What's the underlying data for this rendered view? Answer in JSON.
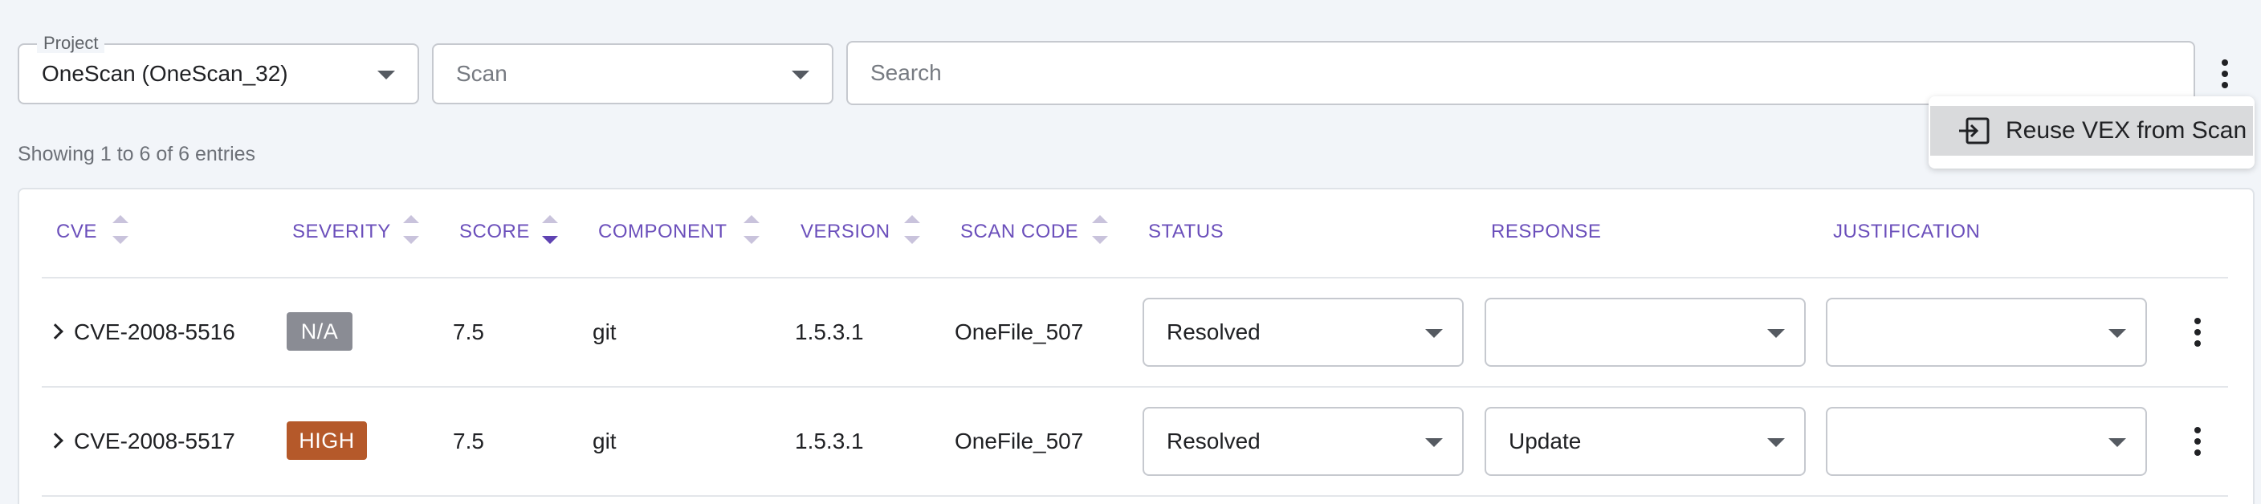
{
  "filters": {
    "project": {
      "label": "Project",
      "value": "OneScan (OneScan_32)"
    },
    "scan": {
      "placeholder": "Scan"
    },
    "search": {
      "placeholder": "Search"
    }
  },
  "menu": {
    "items": [
      {
        "label": "Reuse VEX from Scan",
        "icon": "reuse-import-icon"
      }
    ]
  },
  "table": {
    "entries_text": "Showing 1 to 6 of 6 entries",
    "columns": [
      "CVE",
      "SEVERITY",
      "SCORE",
      "COMPONENT",
      "VERSION",
      "SCAN CODE",
      "STATUS",
      "RESPONSE",
      "JUSTIFICATION"
    ],
    "rows": [
      {
        "cve": "CVE-2008-5516",
        "severity": "N/A",
        "score": "7.5",
        "component": "git",
        "version": "1.5.3.1",
        "scan_code": "OneFile_507",
        "status": "Resolved",
        "response": "",
        "justification": ""
      },
      {
        "cve": "CVE-2008-5517",
        "severity": "HIGH",
        "score": "7.5",
        "component": "git",
        "version": "1.5.3.1",
        "scan_code": "OneFile_507",
        "status": "Resolved",
        "response": "Update",
        "justification": ""
      }
    ]
  },
  "colors": {
    "header_text": "#6b4fbb",
    "severity_na": "#8a8c94",
    "severity_high": "#b5592a"
  }
}
